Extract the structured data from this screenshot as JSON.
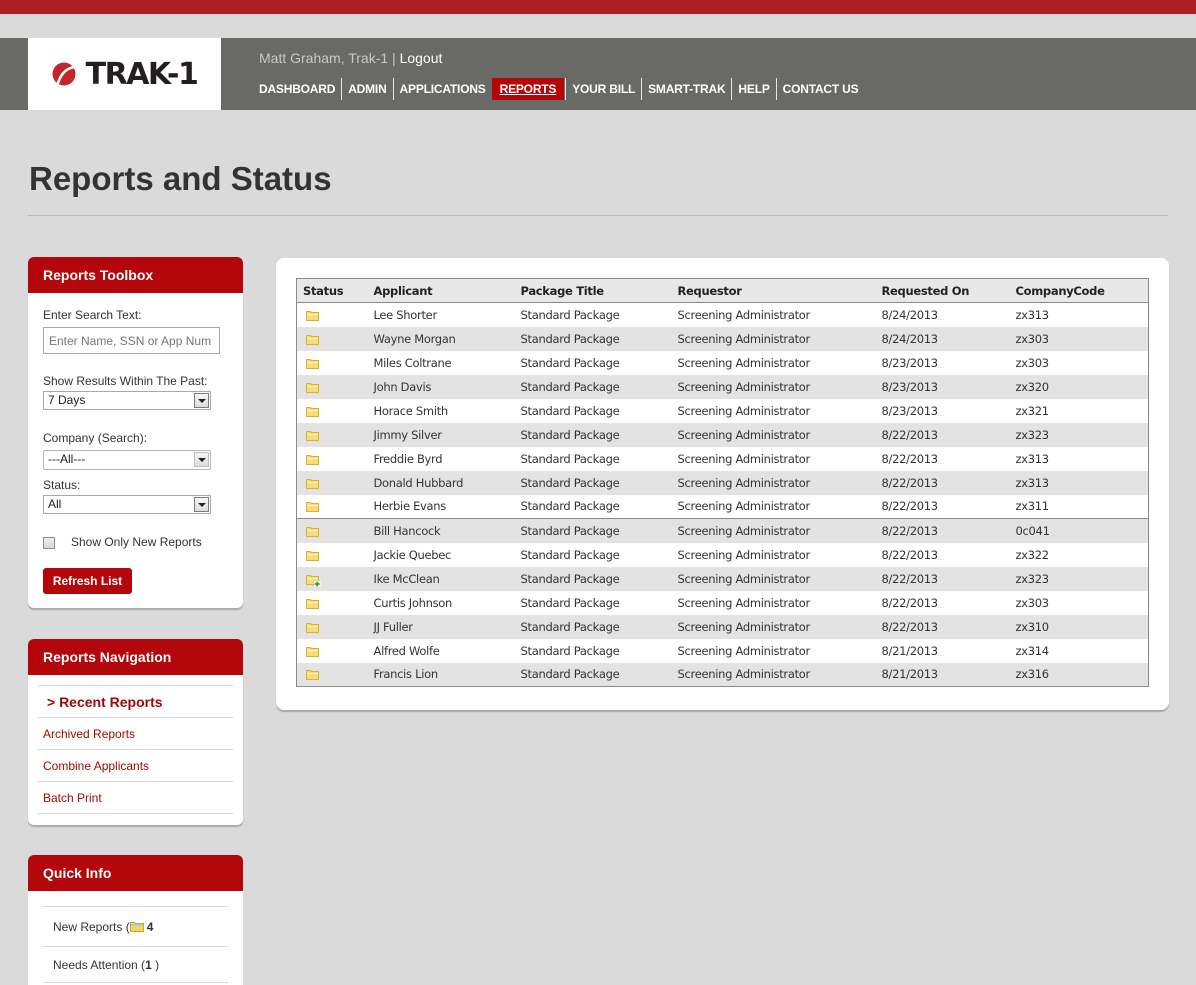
{
  "brand": {
    "name": "TRAK-1",
    "accent": "#b3070b",
    "top_strip": "#b01e23",
    "header_bg": "#696965"
  },
  "user": {
    "name_line": "Matt Graham, Trak-1",
    "separator": "|",
    "logout": "Logout"
  },
  "nav": {
    "items": [
      {
        "label": "DASHBOARD",
        "active": false
      },
      {
        "label": "ADMIN",
        "active": false
      },
      {
        "label": "APPLICATIONS",
        "active": false
      },
      {
        "label": "REPORTS",
        "active": true
      },
      {
        "label": "YOUR BILL",
        "active": false
      },
      {
        "label": "SMART-TRAK",
        "active": false
      },
      {
        "label": "HELP",
        "active": false
      },
      {
        "label": "CONTACT US",
        "active": false
      }
    ]
  },
  "page": {
    "title": "Reports and Status"
  },
  "toolbox": {
    "title": "Reports Toolbox",
    "search_label": "Enter Search Text:",
    "search_placeholder": "Enter Name, SSN or App Num",
    "range_label": "Show Results Within The Past:",
    "range_value": "7 Days",
    "company_label": "Company (Search):",
    "company_value": "---All---",
    "status_label": "Status:",
    "status_value": "All",
    "new_only_label": "Show Only New Reports",
    "new_only_checked": false,
    "refresh_label": "Refresh List"
  },
  "reports_nav": {
    "title": "Reports Navigation",
    "items": [
      {
        "label": "> Recent Reports",
        "current": true
      },
      {
        "label": "Archived Reports",
        "current": false
      },
      {
        "label": "Combine Applicants",
        "current": false
      },
      {
        "label": "Batch Print",
        "current": false
      }
    ]
  },
  "quick_info": {
    "title": "Quick Info",
    "new_reports_label": "New Reports (",
    "new_reports_icon": "folder-icon",
    "new_reports_count": "4",
    "needs_attention_label": "Needs Attention (",
    "needs_attention_count": "1",
    "needs_attention_close": " )"
  },
  "table": {
    "columns": [
      "Status",
      "Applicant",
      "Package Title",
      "Requestor",
      "Requested On",
      "CompanyCode"
    ],
    "rows": [
      {
        "status": "folder",
        "applicant": "Lee Shorter",
        "package": "Standard Package",
        "requestor": "Screening Administrator",
        "date": "8/24/2013",
        "code": "zx313"
      },
      {
        "status": "folder",
        "applicant": "Wayne Morgan",
        "package": "Standard Package",
        "requestor": "Screening Administrator",
        "date": "8/24/2013",
        "code": "zx303"
      },
      {
        "status": "folder",
        "applicant": "Miles Coltrane",
        "package": "Standard Package",
        "requestor": "Screening Administrator",
        "date": "8/23/2013",
        "code": "zx303"
      },
      {
        "status": "folder",
        "applicant": "John Davis",
        "package": "Standard Package",
        "requestor": "Screening Administrator",
        "date": "8/23/2013",
        "code": "zx320"
      },
      {
        "status": "folder",
        "applicant": "Horace Smith",
        "package": "Standard Package",
        "requestor": "Screening Administrator",
        "date": "8/23/2013",
        "code": "zx321"
      },
      {
        "status": "folder",
        "applicant": "Jimmy Silver",
        "package": "Standard Package",
        "requestor": "Screening Administrator",
        "date": "8/22/2013",
        "code": "zx323"
      },
      {
        "status": "folder",
        "applicant": "Freddie Byrd",
        "package": "Standard Package",
        "requestor": "Screening Administrator",
        "date": "8/22/2013",
        "code": "zx313"
      },
      {
        "status": "folder",
        "applicant": "Donald Hubbard",
        "package": "Standard Package",
        "requestor": "Screening Administrator",
        "date": "8/22/2013",
        "code": "zx313"
      },
      {
        "status": "folder",
        "applicant": "Herbie Evans",
        "package": "Standard Package",
        "requestor": "Screening Administrator",
        "date": "8/22/2013",
        "code": "zx311"
      },
      {
        "status": "folder",
        "applicant": "Bill Hancock",
        "package": "Standard Package",
        "requestor": "Screening Administrator",
        "date": "8/22/2013",
        "code": "0c041"
      },
      {
        "status": "folder",
        "applicant": "Jackie Quebec",
        "package": "Standard Package",
        "requestor": "Screening Administrator",
        "date": "8/22/2013",
        "code": "zx322"
      },
      {
        "status": "folder-new",
        "applicant": "Ike McClean",
        "package": "Standard Package",
        "requestor": "Screening Administrator",
        "date": "8/22/2013",
        "code": "zx323"
      },
      {
        "status": "folder",
        "applicant": "Curtis Johnson",
        "package": "Standard Package",
        "requestor": "Screening Administrator",
        "date": "8/22/2013",
        "code": "zx303"
      },
      {
        "status": "folder",
        "applicant": "JJ Fuller",
        "package": "Standard Package",
        "requestor": "Screening Administrator",
        "date": "8/22/2013",
        "code": "zx310"
      },
      {
        "status": "folder",
        "applicant": "Alfred Wolfe",
        "package": "Standard Package",
        "requestor": "Screening Administrator",
        "date": "8/21/2013",
        "code": "zx314"
      },
      {
        "status": "folder",
        "applicant": "Francis Lion",
        "package": "Standard Package",
        "requestor": "Screening Administrator",
        "date": "8/21/2013",
        "code": "zx316"
      }
    ]
  }
}
